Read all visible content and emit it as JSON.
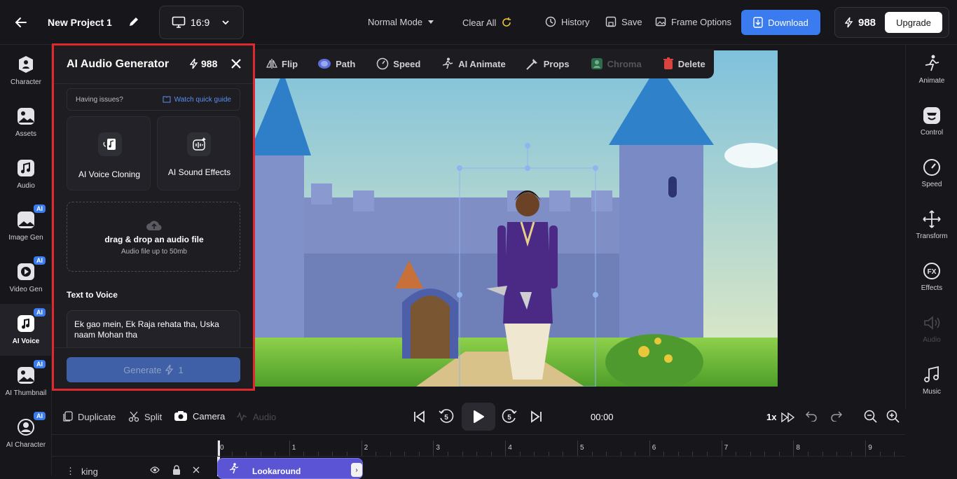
{
  "topbar": {
    "back_label": "",
    "project_title": "New Project 1",
    "aspect_ratio": "16:9",
    "mode_label": "Normal Mode",
    "clear_all_label": "Clear All",
    "history_label": "History",
    "save_label": "Save",
    "frame_options_label": "Frame Options",
    "download_label": "Download",
    "credits": "988",
    "upgrade_label": "Upgrade"
  },
  "left_sidebar": {
    "items": [
      {
        "label": "Character",
        "icon": "character-icon",
        "ai": false
      },
      {
        "label": "Assets",
        "icon": "assets-icon",
        "ai": false
      },
      {
        "label": "Audio",
        "icon": "audio-icon",
        "ai": false
      },
      {
        "label": "Image Gen",
        "icon": "image-gen-icon",
        "ai": true
      },
      {
        "label": "Video Gen",
        "icon": "video-gen-icon",
        "ai": true
      },
      {
        "label": "AI Voice",
        "icon": "ai-voice-icon",
        "ai": true
      },
      {
        "label": "AI Thumbnail",
        "icon": "ai-thumbnail-icon",
        "ai": true
      },
      {
        "label": "AI Character",
        "icon": "ai-character-icon",
        "ai": true
      }
    ],
    "ai_badge": "AI"
  },
  "panel": {
    "title": "AI Audio Generator",
    "credits": "988",
    "issues_text": "Having issues?",
    "guide_link": "Watch quick guide",
    "card_voice_cloning": "AI Voice Cloning",
    "card_sound_effects": "AI Sound Effects",
    "drop_title": "drag & drop an audio file",
    "drop_subtitle": "Audio file up to 50mb",
    "text_to_voice_label": "Text to Voice",
    "text_value": "Ek gao mein, Ek Raja rehata tha, Uska naam Mohan tha",
    "generate_label": "Generate",
    "generate_cost": "1"
  },
  "canvas_toolbar": {
    "flip": "Flip",
    "path": "Path",
    "speed": "Speed",
    "ai_animate": "AI Animate",
    "props": "Props",
    "chroma": "Chroma",
    "delete": "Delete"
  },
  "right_sidebar": {
    "items": [
      {
        "label": "Animate",
        "icon": "animate-icon",
        "enabled": true
      },
      {
        "label": "Control",
        "icon": "control-icon",
        "enabled": true
      },
      {
        "label": "Speed",
        "icon": "speed-icon",
        "enabled": true
      },
      {
        "label": "Transform",
        "icon": "transform-icon",
        "enabled": true
      },
      {
        "label": "Effects",
        "icon": "effects-icon",
        "enabled": true
      },
      {
        "label": "Audio",
        "icon": "audio-icon",
        "enabled": false
      },
      {
        "label": "Music",
        "icon": "music-icon",
        "enabled": true
      }
    ]
  },
  "bottom": {
    "duplicate": "Duplicate",
    "split": "Split",
    "camera": "Camera",
    "audio": "Audio",
    "rewind_seconds": "5",
    "forward_seconds": "5",
    "time": "00:00",
    "speed": "1x"
  },
  "timeline": {
    "ticks": [
      "0",
      "1",
      "2",
      "3",
      "4",
      "5",
      "6",
      "7",
      "8",
      "9"
    ],
    "track_name": "king",
    "clip_label": "Lookaround"
  },
  "colors": {
    "accent_blue": "#3b7bf0",
    "panel_border": "#e0282f",
    "clip_purple": "#5b55d6"
  }
}
